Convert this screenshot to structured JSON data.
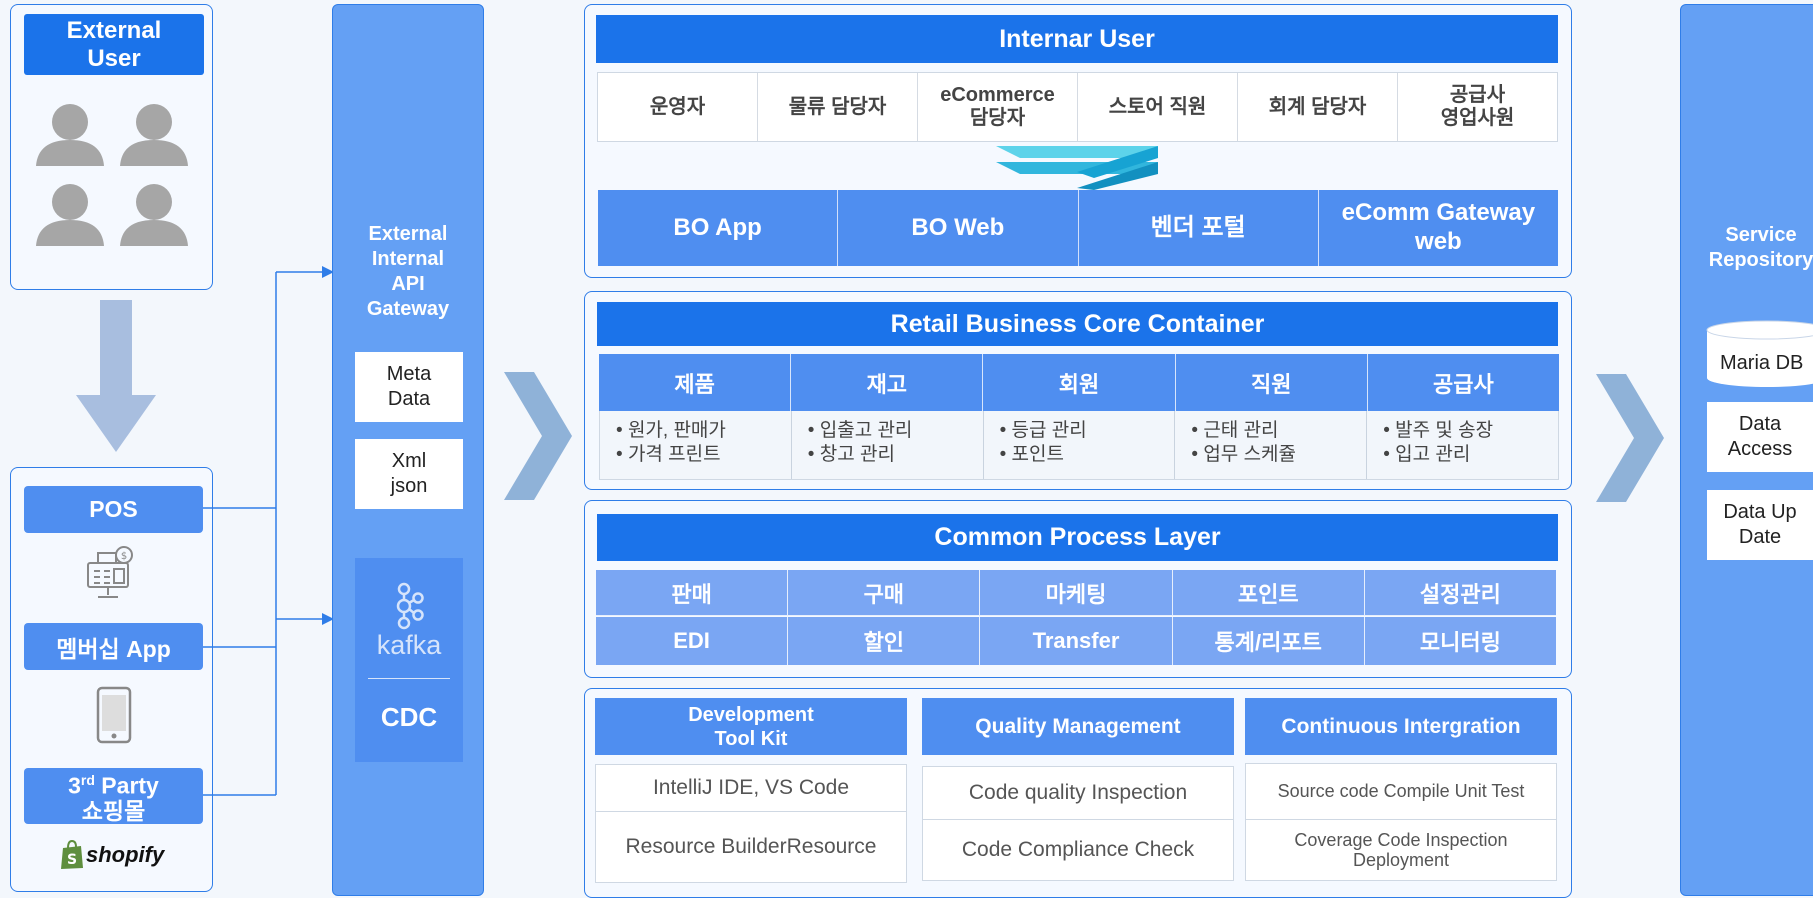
{
  "external_user": {
    "title": "External User"
  },
  "channels": {
    "pos": "POS",
    "membership_app": "멤버십 App",
    "third_party_pre": "3",
    "third_party_sup": "rd",
    "third_party_post": " Party",
    "third_party_line2": "쇼핑몰",
    "shopify": "shopify"
  },
  "gateway": {
    "title": "External Internal API Gateway",
    "meta_data": "Meta Data",
    "xml_json": "Xml json",
    "kafka": "kafka",
    "cdc": "CDC"
  },
  "internal_user": {
    "title": "Internar User",
    "roles": [
      "운영자",
      "물류 담당자",
      "eCommerce\n담당자",
      "스토어 직원",
      "회계 담당자",
      "공급사\n영업사원"
    ],
    "apps": [
      "BO App",
      "BO Web",
      "벤더 포털",
      "eComm Gateway\nweb"
    ]
  },
  "core": {
    "title": "Retail Business Core Container",
    "columns": [
      {
        "header": "제품",
        "items": [
          "원가, 판매가",
          "가격 프린트"
        ]
      },
      {
        "header": "재고",
        "items": [
          "입출고 관리",
          "창고 관리"
        ]
      },
      {
        "header": "회원",
        "items": [
          "등급 관리",
          "포인트"
        ]
      },
      {
        "header": "직원",
        "items": [
          "근태 관리",
          "업무 스케쥴"
        ]
      },
      {
        "header": "공급사",
        "items": [
          "발주 및 송장",
          "입고 관리"
        ]
      }
    ]
  },
  "process": {
    "title": "Common Process Layer",
    "row1": [
      "판매",
      "구매",
      "마케팅",
      "포인트",
      "설정관리"
    ],
    "row2": [
      "EDI",
      "할인",
      "Transfer",
      "통계/리포트",
      "모니터링"
    ]
  },
  "devtools": {
    "columns": [
      {
        "header": "Development\nTool Kit",
        "items": [
          "IntelliJ IDE, VS Code",
          "Resource BuilderResource"
        ]
      },
      {
        "header": "Quality Management",
        "items": [
          "Code quality Inspection",
          "Code Compliance Check"
        ]
      },
      {
        "header": "Continuous Intergration",
        "items": [
          "Source code Compile Unit Test",
          "Coverage Code Inspection\nDeployment"
        ]
      }
    ]
  },
  "repository": {
    "title": "Service Repository",
    "maria_db": "Maria DB",
    "data_access": "Data Access",
    "data_update": "Data Up Date"
  },
  "colors": {
    "primary": "#1b73ea",
    "secondary": "#4f8ef0",
    "light": "#7aa6f3",
    "column": "#64a0f4",
    "arrow": "#8fb2d8"
  }
}
